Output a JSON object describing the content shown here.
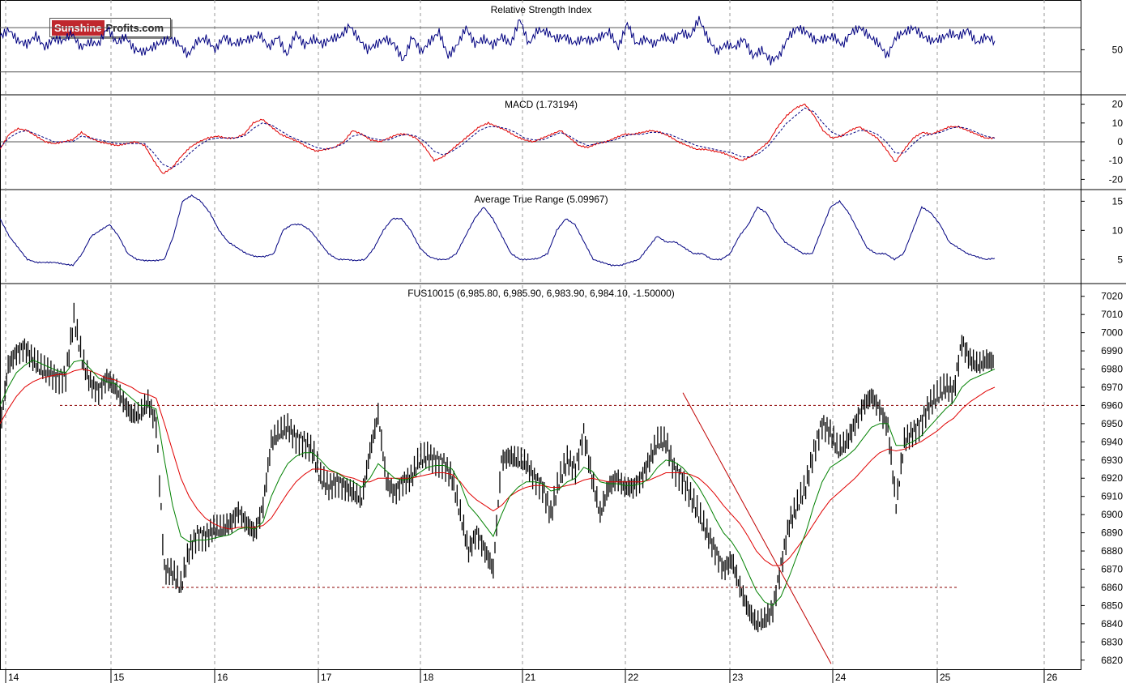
{
  "logo": {
    "part1": "Sunshine",
    "part2": "Profits.com"
  },
  "colors": {
    "price": "#000000",
    "ma_fast": "#008000",
    "ma_slow": "#e00000",
    "indicator": "#000080",
    "signal": "#000080",
    "macd_red": "#e00000",
    "level_line": "#8b0000",
    "trend_line": "#c00000",
    "grid": "#999999"
  },
  "chart_data": [
    {
      "type": "line",
      "title": "Relative Strength Index",
      "y_ticks": [
        50
      ],
      "ylim": [
        10,
        95
      ],
      "reference_levels": [
        70,
        30
      ],
      "x_days": [
        "14",
        "15",
        "16",
        "17",
        "18",
        "21",
        "22",
        "23",
        "24",
        "25",
        "26"
      ],
      "series": [
        {
          "values": [
            62,
            68,
            58,
            55,
            63,
            52,
            60,
            58,
            65,
            52,
            57,
            55,
            70,
            56,
            62,
            50,
            48,
            52,
            57,
            60,
            55,
            45,
            58,
            60,
            50,
            62,
            55,
            58,
            60,
            64,
            52,
            62,
            45,
            65,
            54,
            60,
            55,
            60,
            62,
            72,
            60,
            50,
            55,
            60,
            55,
            40,
            62,
            48,
            58,
            66,
            44,
            54,
            70,
            55,
            60,
            54,
            62,
            55,
            78,
            55,
            68,
            66,
            60,
            62,
            56,
            60,
            58,
            62,
            66,
            52,
            74,
            55,
            60,
            55,
            62,
            58,
            66,
            62,
            78,
            60,
            48,
            55,
            52,
            60,
            44,
            50,
            40,
            45,
            62,
            70,
            66,
            58,
            60,
            62,
            54,
            66,
            70,
            62,
            56,
            44,
            62,
            66,
            70,
            62,
            58,
            60,
            65,
            62,
            68,
            56,
            62,
            58
          ]
        }
      ]
    },
    {
      "type": "line",
      "title": "MACD (1.73194)",
      "y_ticks": [
        20,
        10,
        0,
        -10,
        -20
      ],
      "ylim": [
        -25,
        25
      ],
      "series": [
        {
          "values": [
            -4,
            4,
            7,
            6,
            3,
            0,
            -1,
            0,
            1,
            5,
            2,
            0,
            -1,
            -2,
            -1,
            0,
            -2,
            -10,
            -17,
            -14,
            -8,
            -3,
            0,
            2,
            3,
            2,
            2,
            4,
            10,
            12,
            8,
            4,
            2,
            0,
            -3,
            -5,
            -4,
            -3,
            0,
            6,
            4,
            1,
            0,
            2,
            4,
            4,
            2,
            -3,
            -10,
            -8,
            -4,
            0,
            4,
            8,
            10,
            8,
            6,
            3,
            1,
            0,
            2,
            4,
            6,
            2,
            -2,
            -3,
            -1,
            0,
            2,
            4,
            4,
            5,
            6,
            5,
            3,
            0,
            -2,
            -4,
            -4,
            -5,
            -6,
            -8,
            -10,
            -8,
            -4,
            0,
            8,
            14,
            18,
            20,
            14,
            6,
            2,
            3,
            6,
            8,
            5,
            2,
            -4,
            -11,
            -4,
            2,
            5,
            4,
            6,
            8,
            8,
            6,
            4,
            2,
            2
          ]
        },
        {
          "values": [
            -3,
            2,
            5,
            6,
            4,
            2,
            0,
            0,
            0,
            3,
            2,
            1,
            0,
            -1,
            -1,
            -1,
            -1,
            -6,
            -12,
            -14,
            -11,
            -6,
            -2,
            1,
            2,
            2,
            2,
            3,
            7,
            10,
            9,
            6,
            3,
            1,
            -1,
            -3,
            -4,
            -3,
            -1,
            3,
            4,
            2,
            1,
            1,
            3,
            4,
            3,
            0,
            -5,
            -7,
            -5,
            -2,
            2,
            6,
            8,
            8,
            7,
            5,
            2,
            1,
            1,
            3,
            5,
            3,
            0,
            -2,
            -1,
            0,
            1,
            3,
            4,
            4,
            5,
            5,
            4,
            2,
            0,
            -2,
            -3,
            -4,
            -5,
            -6,
            -8,
            -8,
            -6,
            -2,
            4,
            10,
            14,
            18,
            16,
            10,
            5,
            3,
            4,
            6,
            6,
            4,
            0,
            -6,
            -6,
            -1,
            3,
            4,
            5,
            7,
            8,
            7,
            5,
            3,
            2
          ]
        }
      ]
    },
    {
      "type": "line",
      "title": "Average True Range (5.09967)",
      "y_ticks": [
        15,
        10,
        5
      ],
      "ylim": [
        1,
        17
      ],
      "series": [
        {
          "values": [
            12,
            9,
            7,
            5,
            4.5,
            4.5,
            4.5,
            4.2,
            4,
            6,
            9,
            10,
            11,
            9,
            6,
            5,
            4.8,
            4.8,
            5,
            9,
            15,
            16,
            15,
            13,
            10,
            8,
            7,
            6,
            5.5,
            5.5,
            6,
            10,
            11,
            11,
            10,
            8,
            6,
            5,
            5,
            4.8,
            5,
            7,
            10,
            12,
            12,
            10,
            7,
            5.5,
            5,
            5,
            6,
            9,
            12,
            14,
            12,
            9,
            6,
            5,
            5,
            5.2,
            6,
            10,
            12,
            11,
            8,
            5,
            4.5,
            4,
            4,
            4.5,
            5,
            7,
            9,
            8,
            8,
            7,
            6,
            6,
            5,
            5,
            6,
            9,
            11,
            14,
            13,
            10,
            8,
            7,
            6,
            6,
            10,
            14,
            15,
            13,
            10,
            7,
            6,
            6,
            5,
            6,
            10,
            14,
            13,
            11,
            8,
            7,
            6,
            5.5,
            5,
            5.2
          ]
        }
      ]
    },
    {
      "type": "line",
      "title": "FUS10015 (6,985.80, 6,985.90, 6,983.90, 6,984.10, -1.50000)",
      "y_ticks": [
        7020,
        7010,
        7000,
        6990,
        6980,
        6970,
        6960,
        6950,
        6940,
        6930,
        6920,
        6910,
        6900,
        6890,
        6880,
        6870,
        6860,
        6850,
        6840,
        6830,
        6820
      ],
      "ylim": [
        6815,
        7027
      ],
      "x_days": [
        "14",
        "15",
        "16",
        "17",
        "18",
        "21",
        "22",
        "23",
        "24",
        "25",
        "26"
      ],
      "reference_levels": [
        6960,
        6860
      ],
      "trend_line": {
        "from": [
          0.82,
          6967
        ],
        "to": [
          1.0,
          6818
        ]
      },
      "series": [
        {
          "name": "price",
          "values": [
            6946,
            6982,
            6989,
            6992,
            6985,
            6980,
            6978,
            6975,
            6976,
            7008,
            6985,
            6972,
            6968,
            6975,
            6970,
            6962,
            6955,
            6955,
            6962,
            6950,
            6870,
            6868,
            6860,
            6880,
            6889,
            6888,
            6892,
            6892,
            6895,
            6902,
            6895,
            6890,
            6905,
            6940,
            6945,
            6948,
            6942,
            6940,
            6935,
            6920,
            6915,
            6918,
            6915,
            6912,
            6908,
            6935,
            6955,
            6918,
            6912,
            6918,
            6920,
            6930,
            6932,
            6930,
            6928,
            6920,
            6900,
            6880,
            6890,
            6880,
            6870,
            6930,
            6932,
            6930,
            6928,
            6920,
            6915,
            6900,
            6918,
            6930,
            6925,
            6945,
            6920,
            6900,
            6915,
            6920,
            6915,
            6915,
            6920,
            6930,
            6940,
            6940,
            6925,
            6920,
            6910,
            6900,
            6890,
            6880,
            6870,
            6875,
            6860,
            6848,
            6840,
            6842,
            6848,
            6872,
            6895,
            6905,
            6915,
            6935,
            6950,
            6945,
            6935,
            6940,
            6950,
            6960,
            6965,
            6958,
            6948,
            6905,
            6940,
            6945,
            6950,
            6960,
            6965,
            6970,
            6968,
            6995,
            6985,
            6982,
            6985,
            6984
          ]
        },
        {
          "name": "ma_fast",
          "values": [
            6960,
            6970,
            6978,
            6982,
            6985,
            6983,
            6981,
            6979,
            6978,
            6984,
            6985,
            6980,
            6975,
            6973,
            6972,
            6968,
            6964,
            6960,
            6960,
            6958,
            6930,
            6905,
            6888,
            6885,
            6886,
            6886,
            6887,
            6888,
            6889,
            6892,
            6893,
            6892,
            6896,
            6910,
            6920,
            6928,
            6932,
            6934,
            6934,
            6930,
            6925,
            6923,
            6920,
            6918,
            6915,
            6920,
            6928,
            6924,
            6920,
            6919,
            6920,
            6923,
            6926,
            6927,
            6927,
            6925,
            6917,
            6905,
            6900,
            6894,
            6888,
            6900,
            6910,
            6915,
            6918,
            6918,
            6917,
            6913,
            6914,
            6918,
            6920,
            6926,
            6924,
            6918,
            6917,
            6917,
            6916,
            6916,
            6917,
            6920,
            6926,
            6930,
            6929,
            6926,
            6921,
            6915,
            6907,
            6898,
            6890,
            6885,
            6878,
            6868,
            6858,
            6852,
            6850,
            6855,
            6866,
            6878,
            6890,
            6905,
            6918,
            6926,
            6929,
            6932,
            6936,
            6942,
            6948,
            6950,
            6950,
            6938,
            6938,
            6940,
            6943,
            6948,
            6953,
            6958,
            6962,
            6970,
            6974,
            6976,
            6978,
            6980
          ]
        },
        {
          "name": "ma_slow",
          "values": [
            6950,
            6958,
            6965,
            6970,
            6973,
            6975,
            6976,
            6977,
            6977,
            6979,
            6980,
            6979,
            6977,
            6975,
            6974,
            6972,
            6970,
            6967,
            6966,
            6964,
            6950,
            6935,
            6920,
            6910,
            6903,
            6898,
            6895,
            6893,
            6892,
            6893,
            6893,
            6893,
            6894,
            6898,
            6905,
            6912,
            6918,
            6922,
            6925,
            6925,
            6924,
            6923,
            6921,
            6920,
            6918,
            6918,
            6920,
            6920,
            6920,
            6920,
            6920,
            6921,
            6922,
            6923,
            6923,
            6922,
            6918,
            6912,
            6908,
            6905,
            6902,
            6905,
            6910,
            6913,
            6915,
            6916,
            6916,
            6915,
            6915,
            6916,
            6917,
            6919,
            6920,
            6919,
            6918,
            6918,
            6918,
            6918,
            6918,
            6919,
            6921,
            6923,
            6923,
            6923,
            6922,
            6920,
            6916,
            6911,
            6905,
            6900,
            6895,
            6888,
            6880,
            6875,
            6872,
            6872,
            6876,
            6882,
            6888,
            6895,
            6902,
            6908,
            6912,
            6916,
            6920,
            6925,
            6930,
            6934,
            6936,
            6935,
            6936,
            6938,
            6940,
            6943,
            6946,
            6950,
            6953,
            6958,
            6962,
            6965,
            6968,
            6970
          ]
        }
      ]
    }
  ]
}
